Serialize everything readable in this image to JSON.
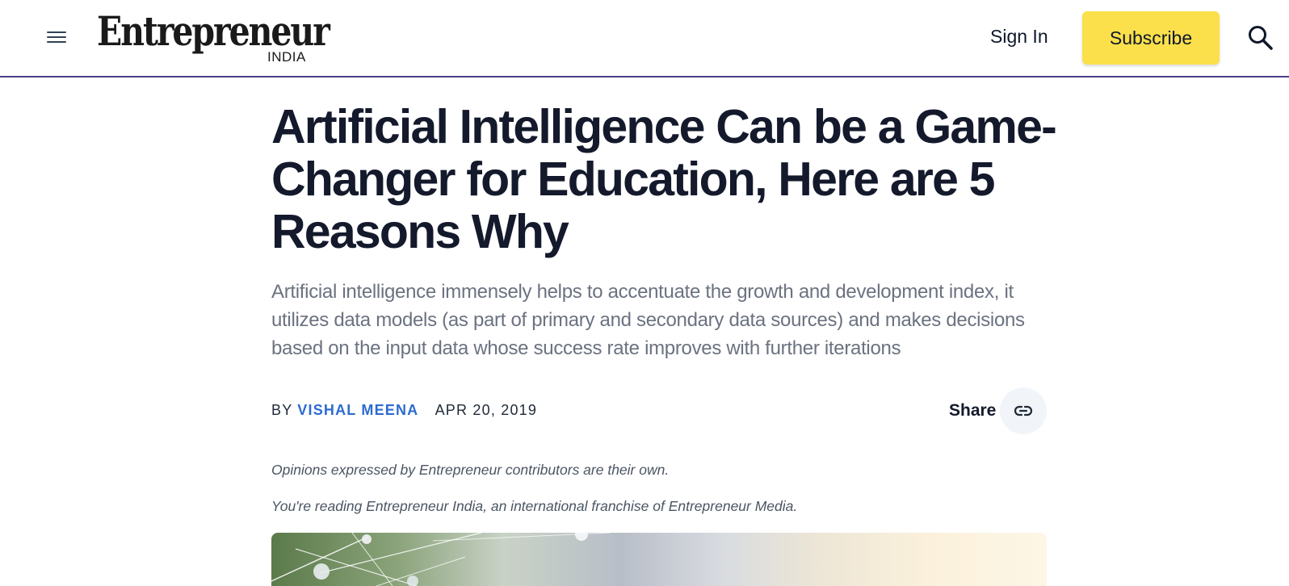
{
  "header": {
    "logo_text": "Entrepreneur",
    "logo_sub": "INDIA",
    "signin_label": "Sign In",
    "subscribe_label": "Subscribe"
  },
  "article": {
    "title": "Artificial Intelligence Can be a Game-Changer for Education, Here are 5 Reasons Why",
    "dek": "Artificial intelligence immensely helps to accentuate the growth and development index, it utilizes data models (as part of primary and secondary data sources) and makes decisions based on the input data whose success rate improves with further iterations",
    "by_prefix": "BY",
    "author": "VISHAL MEENA",
    "date": "APR 20, 2019",
    "share_label": "Share",
    "note1": "Opinions expressed by Entrepreneur contributors are their own.",
    "note2": "You're reading Entrepreneur India, an international franchise of Entrepreneur Media."
  },
  "icons": {
    "menu": "hamburger-icon",
    "search": "search-icon",
    "share": "link-icon"
  },
  "colors": {
    "subscribe_bg": "#fbe04b",
    "author_link": "#2d6bd0",
    "header_border": "#4b3f8a"
  }
}
